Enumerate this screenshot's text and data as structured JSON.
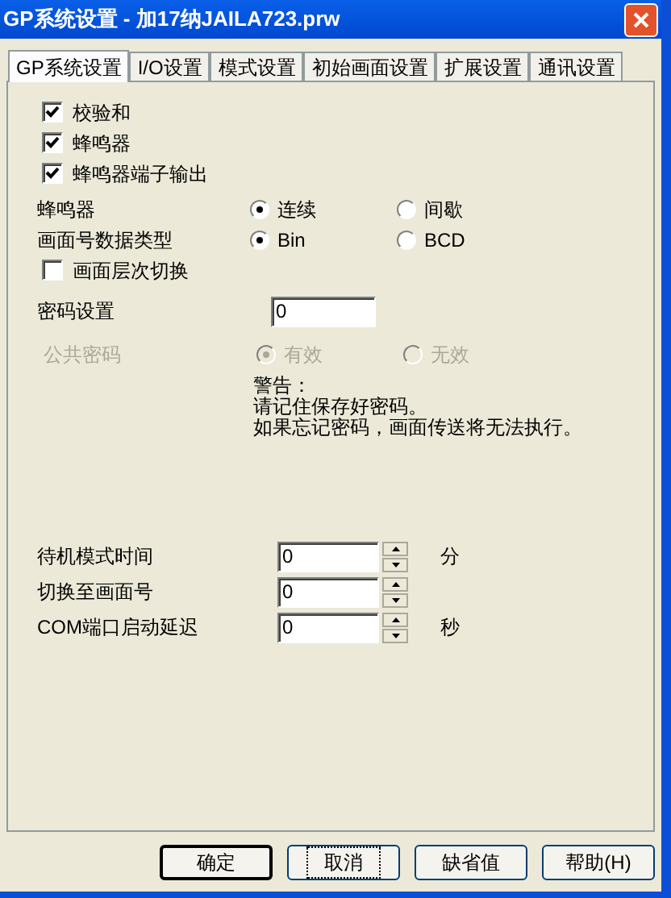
{
  "window": {
    "title": "GP系统设置 - 加17纳JAILA723.prw"
  },
  "tabs": [
    {
      "label": "GP系统设置",
      "selected": true
    },
    {
      "label": "I/O设置",
      "selected": false
    },
    {
      "label": "模式设置",
      "selected": false
    },
    {
      "label": "初始画面设置",
      "selected": false
    },
    {
      "label": "扩展设置",
      "selected": false
    },
    {
      "label": "通讯设置",
      "selected": false
    }
  ],
  "checkboxes": [
    {
      "label": "校验和",
      "checked": true
    },
    {
      "label": "蜂鸣器",
      "checked": true
    },
    {
      "label": "蜂鸣器端子输出",
      "checked": true
    }
  ],
  "radio_groups": [
    {
      "label": "蜂鸣器",
      "disabled": false,
      "options": [
        {
          "label": "连续",
          "selected": true
        },
        {
          "label": "间歇",
          "selected": false
        }
      ]
    },
    {
      "label": "画面号数据类型",
      "disabled": false,
      "options": [
        {
          "label": "Bin",
          "selected": true
        },
        {
          "label": "BCD",
          "selected": false
        }
      ]
    }
  ],
  "layer_switch": {
    "label": "画面层次切换",
    "checked": false
  },
  "password": {
    "label": "密码设置",
    "value": "0"
  },
  "public_password": {
    "label": "公共密码",
    "disabled": true,
    "options": [
      {
        "label": "有效",
        "selected": true
      },
      {
        "label": "无效",
        "selected": false
      }
    ]
  },
  "warning": [
    "警告：",
    "请记住保存好密码。",
    "如果忘记密码，画面传送将无法执行。"
  ],
  "spinners": [
    {
      "label": "待机模式时间",
      "value": "0",
      "unit": "分"
    },
    {
      "label": "切换至画面号",
      "value": "0"
    },
    {
      "label": "COM端口启动延迟",
      "value": "0",
      "unit": "秒"
    }
  ],
  "buttons": [
    {
      "label": "确定",
      "default": true,
      "focused": false
    },
    {
      "label": "取消",
      "default": false,
      "focused": true
    },
    {
      "label": "缺省值",
      "default": false,
      "focused": false
    },
    {
      "label": "帮助(H)",
      "default": false,
      "focused": false
    }
  ]
}
